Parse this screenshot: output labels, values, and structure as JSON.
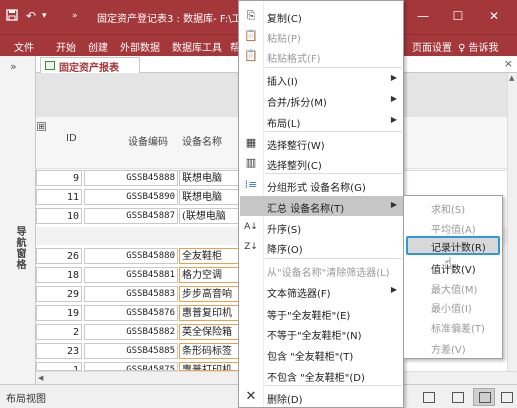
{
  "titlebar": {
    "save_icon": "save-icon",
    "undo_icon": "undo-icon",
    "customize_icon": "customize-quick-access-icon",
    "title": "固定资产登记表3 : 数据库- F:\\工",
    "min_glyph": "—",
    "max_glyph": "☐",
    "close_glyph": "✕"
  },
  "ribbon": {
    "tabs": [
      "文件",
      "开始",
      "创建",
      "外部数据",
      "数据库工具",
      "帮"
    ],
    "right_tab": "页面设置",
    "tell_me": "♀ 告诉我"
  },
  "nav_pane": {
    "toggle": "»",
    "label": "导航窗格"
  },
  "document": {
    "tab_label": "固定资产报表",
    "close_glyph": "×"
  },
  "report": {
    "expander": "⊞",
    "headers": {
      "id": "ID",
      "code": "设备编码",
      "name": "设备名称"
    },
    "group1": [
      {
        "id": "9",
        "code": "GSSB45888",
        "name": "联想电脑"
      },
      {
        "id": "11",
        "code": "GSSB45890",
        "name": "联想电脑"
      },
      {
        "id": "10",
        "code": "GSSB45887",
        "name": "(联想电脑"
      }
    ],
    "group2": [
      {
        "id": "26",
        "code": "GSSB45880",
        "name": "全友鞋柜"
      },
      {
        "id": "18",
        "code": "GSSB45881",
        "name": "格力空调"
      },
      {
        "id": "29",
        "code": "GSSB45883",
        "name": "步步高音响"
      },
      {
        "id": "19",
        "code": "GSSB45876",
        "name": "惠普复印机"
      },
      {
        "id": "2",
        "code": "GSSB45882",
        "name": "英全保险箱"
      },
      {
        "id": "23",
        "code": "GSSB45885",
        "name": "条形码标签"
      },
      {
        "id": "1",
        "code": "GSSB45875",
        "name": "惠普打印机"
      }
    ]
  },
  "context_menu": {
    "items": [
      {
        "icon": "copy-icon",
        "glyph": "⎘",
        "label": "复制(C)",
        "enabled": true,
        "submenu": false
      },
      {
        "icon": "paste-icon",
        "glyph": "📋",
        "label": "粘贴(P)",
        "enabled": false,
        "submenu": false
      },
      {
        "icon": "paste-format-icon",
        "glyph": "📋",
        "label": "粘贴格式(F)",
        "enabled": false,
        "submenu": false
      },
      {
        "icon": "",
        "glyph": "",
        "label": "插入(I)",
        "enabled": true,
        "submenu": true
      },
      {
        "icon": "",
        "glyph": "",
        "label": "合并/拆分(M)",
        "enabled": true,
        "submenu": true
      },
      {
        "icon": "",
        "glyph": "",
        "label": "布局(L)",
        "enabled": true,
        "submenu": true
      },
      {
        "icon": "select-row-icon",
        "glyph": "▦",
        "label": "选择整行(W)",
        "enabled": true,
        "submenu": false
      },
      {
        "icon": "select-column-icon",
        "glyph": "▥",
        "label": "选择整列(C)",
        "enabled": true,
        "submenu": false
      },
      {
        "icon": "group-by-icon",
        "glyph": "⁞≡",
        "label": "分组形式 设备名称(G)",
        "enabled": true,
        "submenu": false
      },
      {
        "icon": "",
        "glyph": "",
        "label": "汇总 设备名称(T)",
        "enabled": true,
        "submenu": true,
        "highlighted": true
      },
      {
        "icon": "sort-ascending-icon",
        "glyph": "A↓",
        "label": "升序(S)",
        "enabled": true,
        "submenu": false
      },
      {
        "icon": "sort-descending-icon",
        "glyph": "Z↓",
        "label": "降序(O)",
        "enabled": true,
        "submenu": false
      },
      {
        "icon": "",
        "glyph": "",
        "label": "从\"设备名称\"清除筛选器(L)",
        "enabled": false,
        "submenu": false
      },
      {
        "icon": "",
        "glyph": "",
        "label": "文本筛选器(F)",
        "enabled": true,
        "submenu": true
      },
      {
        "icon": "",
        "glyph": "",
        "label": "等于\"全友鞋柜\"(E)",
        "enabled": true,
        "submenu": false
      },
      {
        "icon": "",
        "glyph": "",
        "label": "不等于\"全友鞋柜\"(N)",
        "enabled": true,
        "submenu": false
      },
      {
        "icon": "",
        "glyph": "",
        "label": "包含 \"全友鞋柜\"(T)",
        "enabled": true,
        "submenu": false
      },
      {
        "icon": "",
        "glyph": "",
        "label": "不包含 \"全友鞋柜\"(D)",
        "enabled": true,
        "submenu": false
      },
      {
        "icon": "delete-icon",
        "glyph": "✕",
        "label": "删除(D)",
        "enabled": true,
        "submenu": false
      }
    ]
  },
  "submenu": {
    "items": [
      {
        "label": "求和(S)",
        "enabled": false
      },
      {
        "label": "平均值(A)",
        "enabled": false
      },
      {
        "label": "记录计数(R)",
        "enabled": true,
        "focused": true
      },
      {
        "label": "值计数(V)",
        "enabled": true
      },
      {
        "label": "最大值(M)",
        "enabled": false
      },
      {
        "label": "最小值(I)",
        "enabled": false
      },
      {
        "label": "标准偏差(T)",
        "enabled": false
      },
      {
        "label": "方差(V)",
        "enabled": false
      }
    ]
  },
  "status_bar": {
    "text": "布局视图"
  }
}
